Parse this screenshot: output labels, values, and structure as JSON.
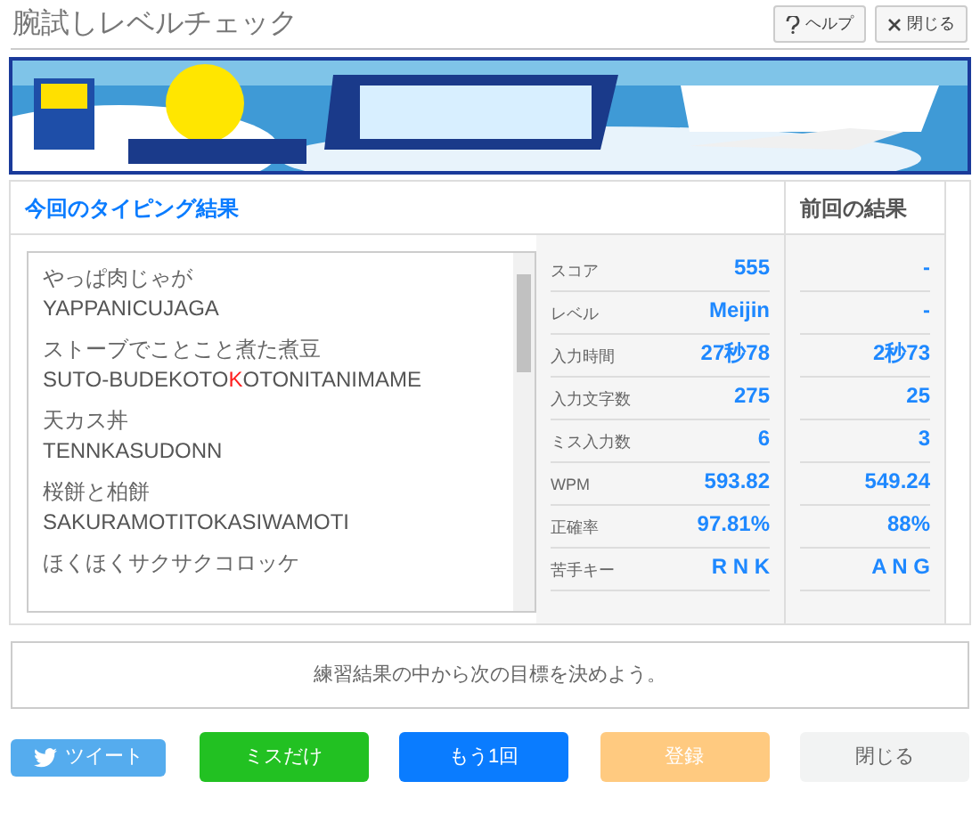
{
  "window": {
    "title": "腕試しレベルチェック"
  },
  "header_buttons": [
    {
      "kind": "help",
      "label": "ヘルプ"
    },
    {
      "kind": "close",
      "label": "閉じる"
    }
  ],
  "current": {
    "heading": "今回のタイピング結果",
    "words": [
      {
        "text": "やっぱ肉じゃが",
        "romaji": [
          {
            "text": "YAPPANICUJAGA",
            "miss": false
          }
        ]
      },
      {
        "text": "ストーブでことこと煮た煮豆",
        "romaji": [
          {
            "text": "SUTO-BUDEKOTO",
            "miss": false
          },
          {
            "text": "K",
            "miss": true
          },
          {
            "text": "OTONITANIMAME",
            "miss": false
          }
        ]
      },
      {
        "text": "天カス丼",
        "romaji": [
          {
            "text": "TENNKASUDONN",
            "miss": false
          }
        ]
      },
      {
        "text": "桜餅と柏餅",
        "romaji": [
          {
            "text": "SAKURAMOTITOKASIWAMOTI",
            "miss": false
          }
        ]
      },
      {
        "text": "ほくほくサクサクコロッケ"
      }
    ],
    "stats": [
      {
        "label": "スコア",
        "value": "555"
      },
      {
        "label": "レベル",
        "value": "Meijin"
      },
      {
        "label": "入力時間",
        "value": "27秒78"
      },
      {
        "label": "入力文字数",
        "value": "275"
      },
      {
        "label": "ミス入力数",
        "value": "6"
      },
      {
        "label": "WPM",
        "value": "593.82"
      },
      {
        "label": "正確率",
        "value": "97.81%"
      },
      {
        "label": "苦手キー",
        "value": "R N K"
      }
    ]
  },
  "previous": {
    "heading": "前回の結果",
    "values": [
      "-",
      "-",
      "2秒73",
      "25",
      "3",
      "549.24",
      "88%",
      "A N G"
    ]
  },
  "message": "練習結果の中から次の目標を決めよう。",
  "buttons": [
    {
      "kind": "tweet",
      "label": "ツイート",
      "disabled": false
    },
    {
      "kind": "miss",
      "label": "ミスだけ",
      "disabled": false
    },
    {
      "kind": "retry",
      "label": "もう1回",
      "disabled": false
    },
    {
      "kind": "register",
      "label": "登録",
      "disabled": true
    },
    {
      "kind": "close",
      "label": "閉じる",
      "disabled": false
    }
  ]
}
